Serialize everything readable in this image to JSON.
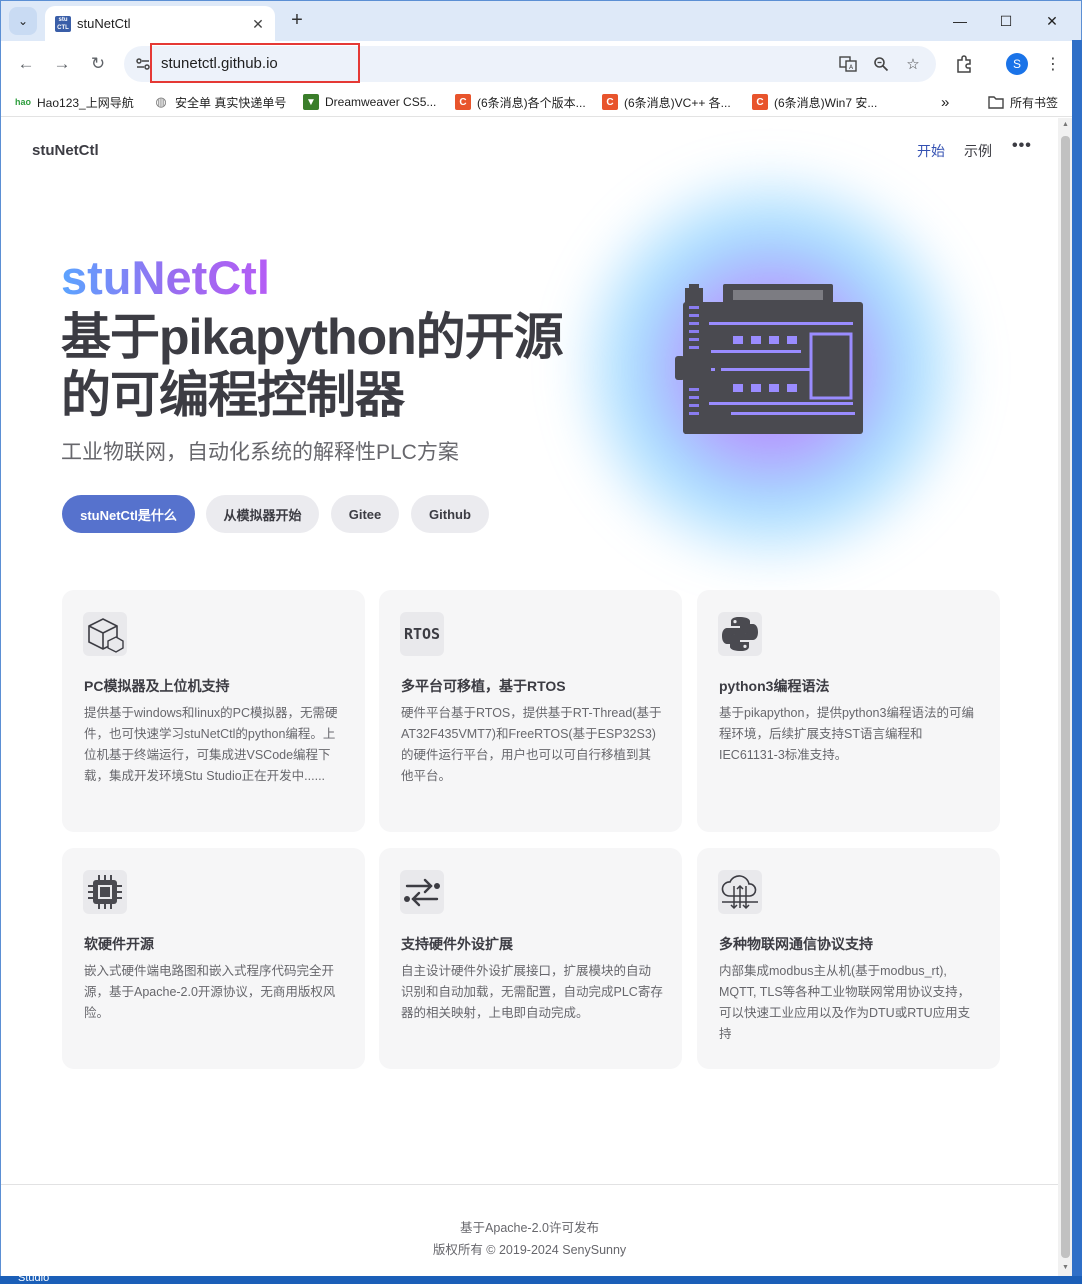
{
  "browser": {
    "tab_title": "stuNetCtl",
    "favicon_text": "stu CTL",
    "url": "stunetctl.github.io",
    "avatar_letter": "S",
    "bookmarks": [
      {
        "label": "Hao123_上网导航",
        "icon": "hao123-icon",
        "color": "#2e9e3e"
      },
      {
        "label": "安全单 真实快递单号",
        "icon": "globe-icon",
        "color": "#777777"
      },
      {
        "label": "Dreamweaver CS5...",
        "icon": "dreamweaver-icon",
        "color": "#3a7d2a"
      },
      {
        "label": "(6条消息)各个版本...",
        "icon": "csdn-icon",
        "color": "#e8542c"
      },
      {
        "label": "(6条消息)VC++ 各...",
        "icon": "csdn-icon",
        "color": "#e8542c"
      },
      {
        "label": "(6条消息)Win7 安...",
        "icon": "csdn-icon",
        "color": "#e8542c"
      }
    ],
    "all_bookmarks": "所有书签",
    "overflow": "»"
  },
  "site": {
    "title": "stuNetCtl",
    "nav": [
      {
        "label": "开始",
        "active": true
      },
      {
        "label": "示例",
        "active": false
      }
    ],
    "more": "•••"
  },
  "hero": {
    "name": "stuNetCtl",
    "text_line1": "基于pikapython的开源",
    "text_line2": "的可编程控制器",
    "tagline": "工业物联网，自动化系统的解释性PLC方案",
    "actions": [
      {
        "label": "stuNetCtl是什么",
        "theme": "brand"
      },
      {
        "label": "从模拟器开始",
        "theme": "alt"
      },
      {
        "label": "Gitee",
        "theme": "alt"
      },
      {
        "label": "Github",
        "theme": "alt"
      }
    ],
    "image_icon": "plc-controller-icon"
  },
  "features": [
    {
      "icon": "package-icon",
      "title": "PC模拟器及上位机支持",
      "details": "提供基于windows和linux的PC模拟器，无需硬件，也可快速学习stuNetCtl的python编程。上位机基于终端运行，可集成进VSCode编程下载，集成开发环境Stu Studio正在开发中......"
    },
    {
      "icon": "rtos-icon",
      "icon_text": "RTOS",
      "title": "多平台可移植，基于RTOS",
      "details": "硬件平台基于RTOS，提供基于RT-Thread(基于AT32F435VMT7)和FreeRTOS(基于ESP32S3)的硬件运行平台，用户也可以可自行移植到其他平台。"
    },
    {
      "icon": "python-icon",
      "title": "python3编程语法",
      "details": "基于pikapython，提供python3编程语法的可编程环境，后续扩展支持ST语言编程和IEC61131-3标准支持。"
    },
    {
      "icon": "chip-icon",
      "title": "软硬件开源",
      "details": "嵌入式硬件端电路图和嵌入式程序代码完全开源，基于Apache-2.0开源协议，无商用版权风险。"
    },
    {
      "icon": "transfer-arrows-icon",
      "title": "支持硬件外设扩展",
      "details": "自主设计硬件外设扩展接口，扩展模块的自动识别和自动加载，无需配置，自动完成PLC寄存器的相关映射，上电即自动完成。"
    },
    {
      "icon": "cloud-network-icon",
      "title": "多种物联网通信协议支持",
      "details": "内部集成modbus主从机(基于modbus_rt), MQTT, TLS等各种工业物联网常用协议支持，可以快速工业应用以及作为DTU或RTU应用支持"
    }
  ],
  "footer": {
    "message": "基于Apache-2.0许可发布",
    "copyright": "版权所有 © 2019-2024 SenySunny"
  },
  "taskbar": {
    "label": "Studio"
  },
  "colors": {
    "brand": "#5672cd",
    "nav_active": "#3451b2",
    "chrome_tabstrip": "#dee9f8",
    "highlight_box": "#e53935"
  }
}
